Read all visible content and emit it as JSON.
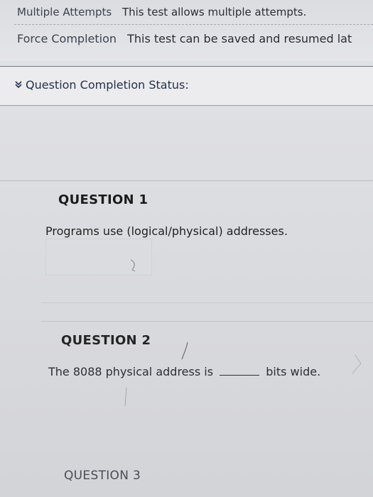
{
  "header": {
    "rows": [
      {
        "label": "Multiple Attempts",
        "value": "This test allows multiple attempts."
      },
      {
        "label": "Force Completion",
        "value": "This test can be saved and resumed lat"
      }
    ]
  },
  "status_panel": {
    "label": "Question Completion Status:",
    "icon": "double-chevron-down-icon"
  },
  "questions": [
    {
      "heading": "QUESTION 1",
      "text": "Programs use (logical/physical) addresses."
    },
    {
      "heading": "QUESTION 2",
      "text_before": "The 8088 physical address is",
      "text_after": "bits wide."
    },
    {
      "heading": "QUESTION 3"
    }
  ]
}
